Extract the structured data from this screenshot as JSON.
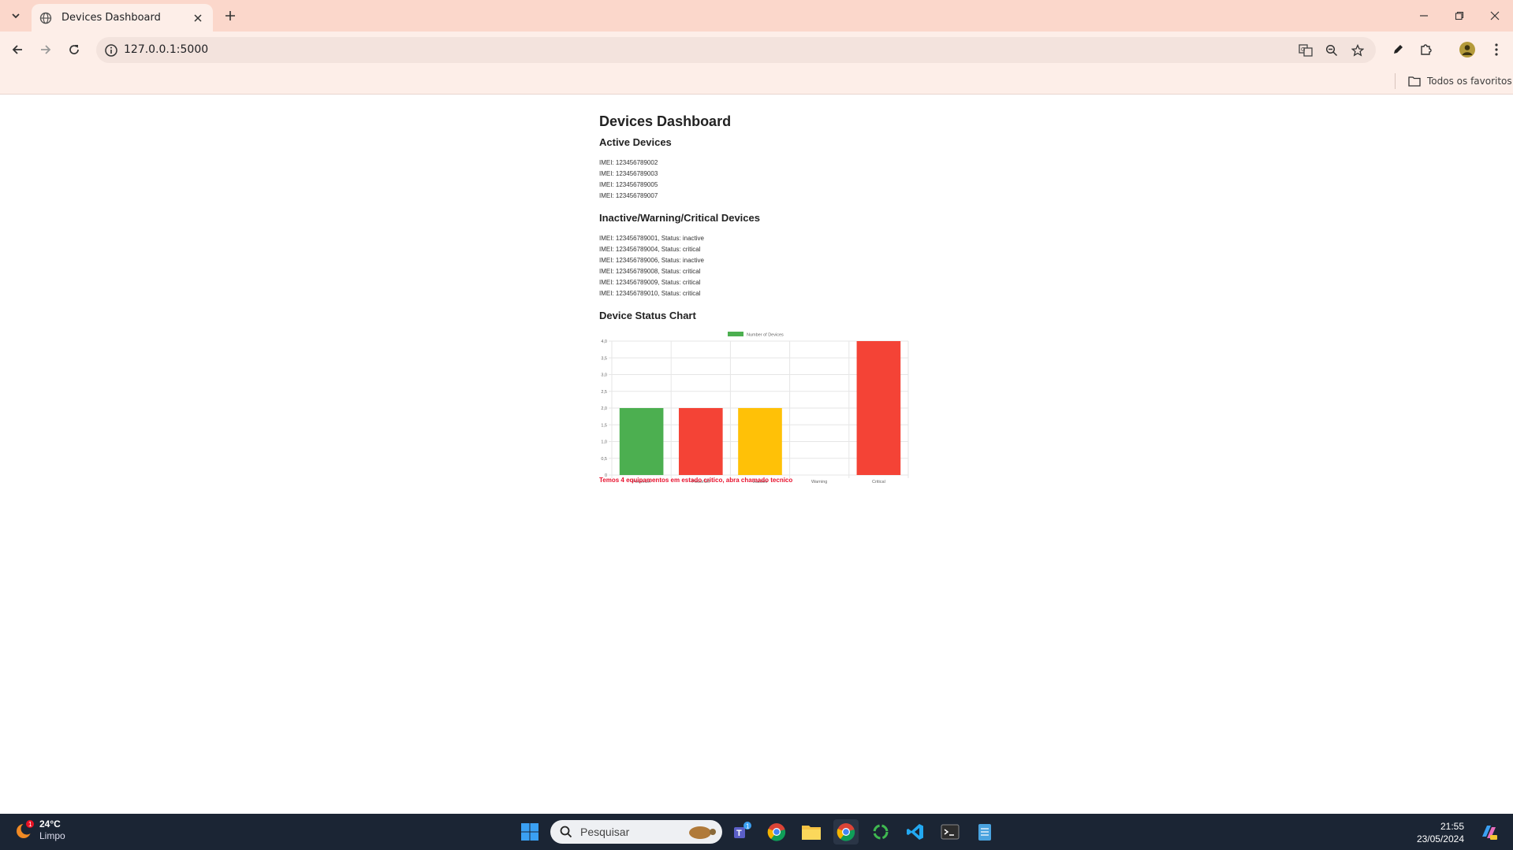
{
  "browser": {
    "tab_title": "Devices Dashboard",
    "url": "127.0.0.1:5000",
    "bookmarks_label": "Todos os favoritos"
  },
  "page": {
    "title": "Devices Dashboard",
    "active_heading": "Active Devices",
    "active_devices": [
      "IMEI: 123456789002",
      "IMEI: 123456789003",
      "IMEI: 123456789005",
      "IMEI: 123456789007"
    ],
    "inactive_heading": "Inactive/Warning/Critical Devices",
    "inactive_devices": [
      "IMEI: 123456789001, Status: inactive",
      "IMEI: 123456789004, Status: critical",
      "IMEI: 123456789006, Status: inactive",
      "IMEI: 123456789008, Status: critical",
      "IMEI: 123456789009, Status: critical",
      "IMEI: 123456789010, Status: critical"
    ],
    "chart_heading": "Device Status Chart",
    "alert": "Temos 4 equipamentos em estado critico, abra chamado tecnico"
  },
  "chart_data": {
    "type": "bar",
    "categories": [
      "PowerOn",
      "PowerOff",
      "Inactive",
      "Warning",
      "Critical"
    ],
    "series": [
      {
        "name": "Number of Devices",
        "values": [
          2,
          2,
          2,
          0,
          4
        ]
      }
    ],
    "colors": [
      "#4caf50",
      "#f44336",
      "#ffc107",
      "#ff9800",
      "#f44336"
    ],
    "legend_color": "#4caf50",
    "ylim": [
      0,
      4
    ],
    "yticks": [
      "0",
      "0,5",
      "1,0",
      "1,5",
      "2,0",
      "2,5",
      "3,0",
      "3,5",
      "4,0"
    ],
    "legend": "top-center",
    "grid": true
  },
  "taskbar": {
    "weather_temp": "24°C",
    "weather_cond": "Limpo",
    "weather_badge": "1",
    "search_placeholder": "Pesquisar",
    "time": "21:55",
    "date": "23/05/2024",
    "teams_badge": "1"
  }
}
